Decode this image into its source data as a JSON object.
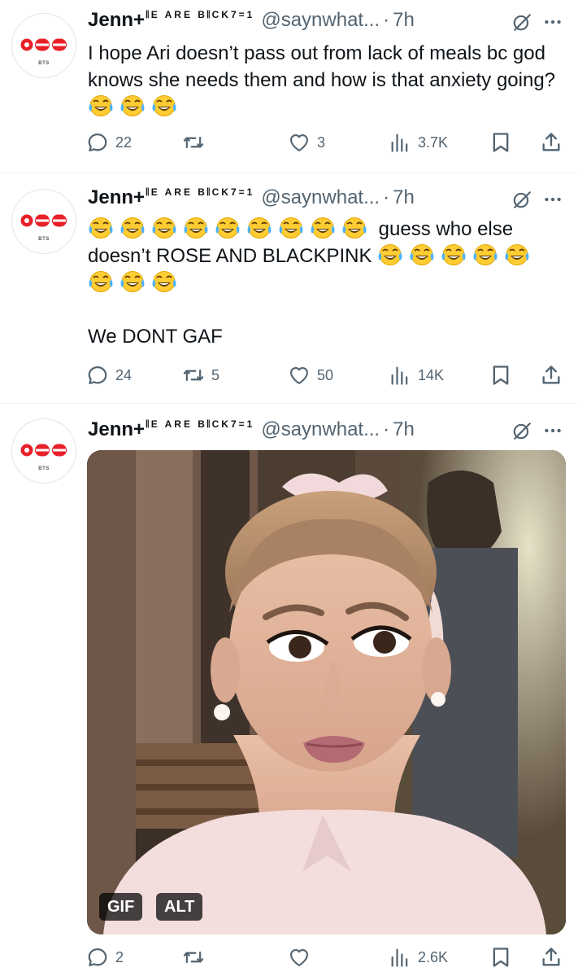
{
  "tweets": [
    {
      "author": "Jenn+",
      "author_deco": "𝄃E ARE B𝄃CK7=1",
      "handle": "@saynwhat...",
      "dot": "·",
      "time": "7h",
      "avatar_text": "BTS",
      "text": "I hope Ari doesn’t pass out from lack of meals bc god knows she needs them and how is that anxiety going?",
      "replies": "22",
      "retweets": "",
      "likes": "3",
      "views": "3.7K"
    },
    {
      "author": "Jenn+",
      "author_deco": "𝄃E ARE B𝄃CK7=1",
      "handle": "@saynwhat...",
      "dot": "·",
      "time": "7h",
      "avatar_text": "BTS",
      "text_part1": "guess who else doesn’t ROSE AND BLACKPINK",
      "text_part2": "We DONT GAF",
      "replies": "24",
      "retweets": "5",
      "likes": "50",
      "views": "14K"
    },
    {
      "author": "Jenn+",
      "author_deco": "𝄃E ARE B𝄃CK7=1",
      "handle": "@saynwhat...",
      "dot": "·",
      "time": "7h",
      "avatar_text": "BTS",
      "media_badge_gif": "GIF",
      "media_badge_alt": "ALT",
      "replies": "2",
      "retweets": "",
      "likes": "",
      "views": "2.6K"
    }
  ],
  "colors": {
    "text": "#0f1419",
    "secondary": "#536471",
    "divider": "#eff3f4",
    "logo_red": "#e8202a"
  },
  "icons": {
    "reply": "reply-icon",
    "retweet": "retweet-icon",
    "like": "heart-icon",
    "views": "views-icon",
    "bookmark": "bookmark-icon",
    "share": "share-icon",
    "grok": "grok-icon",
    "more": "more-icon",
    "emoji": "face-with-tears-of-joy-emoji"
  }
}
